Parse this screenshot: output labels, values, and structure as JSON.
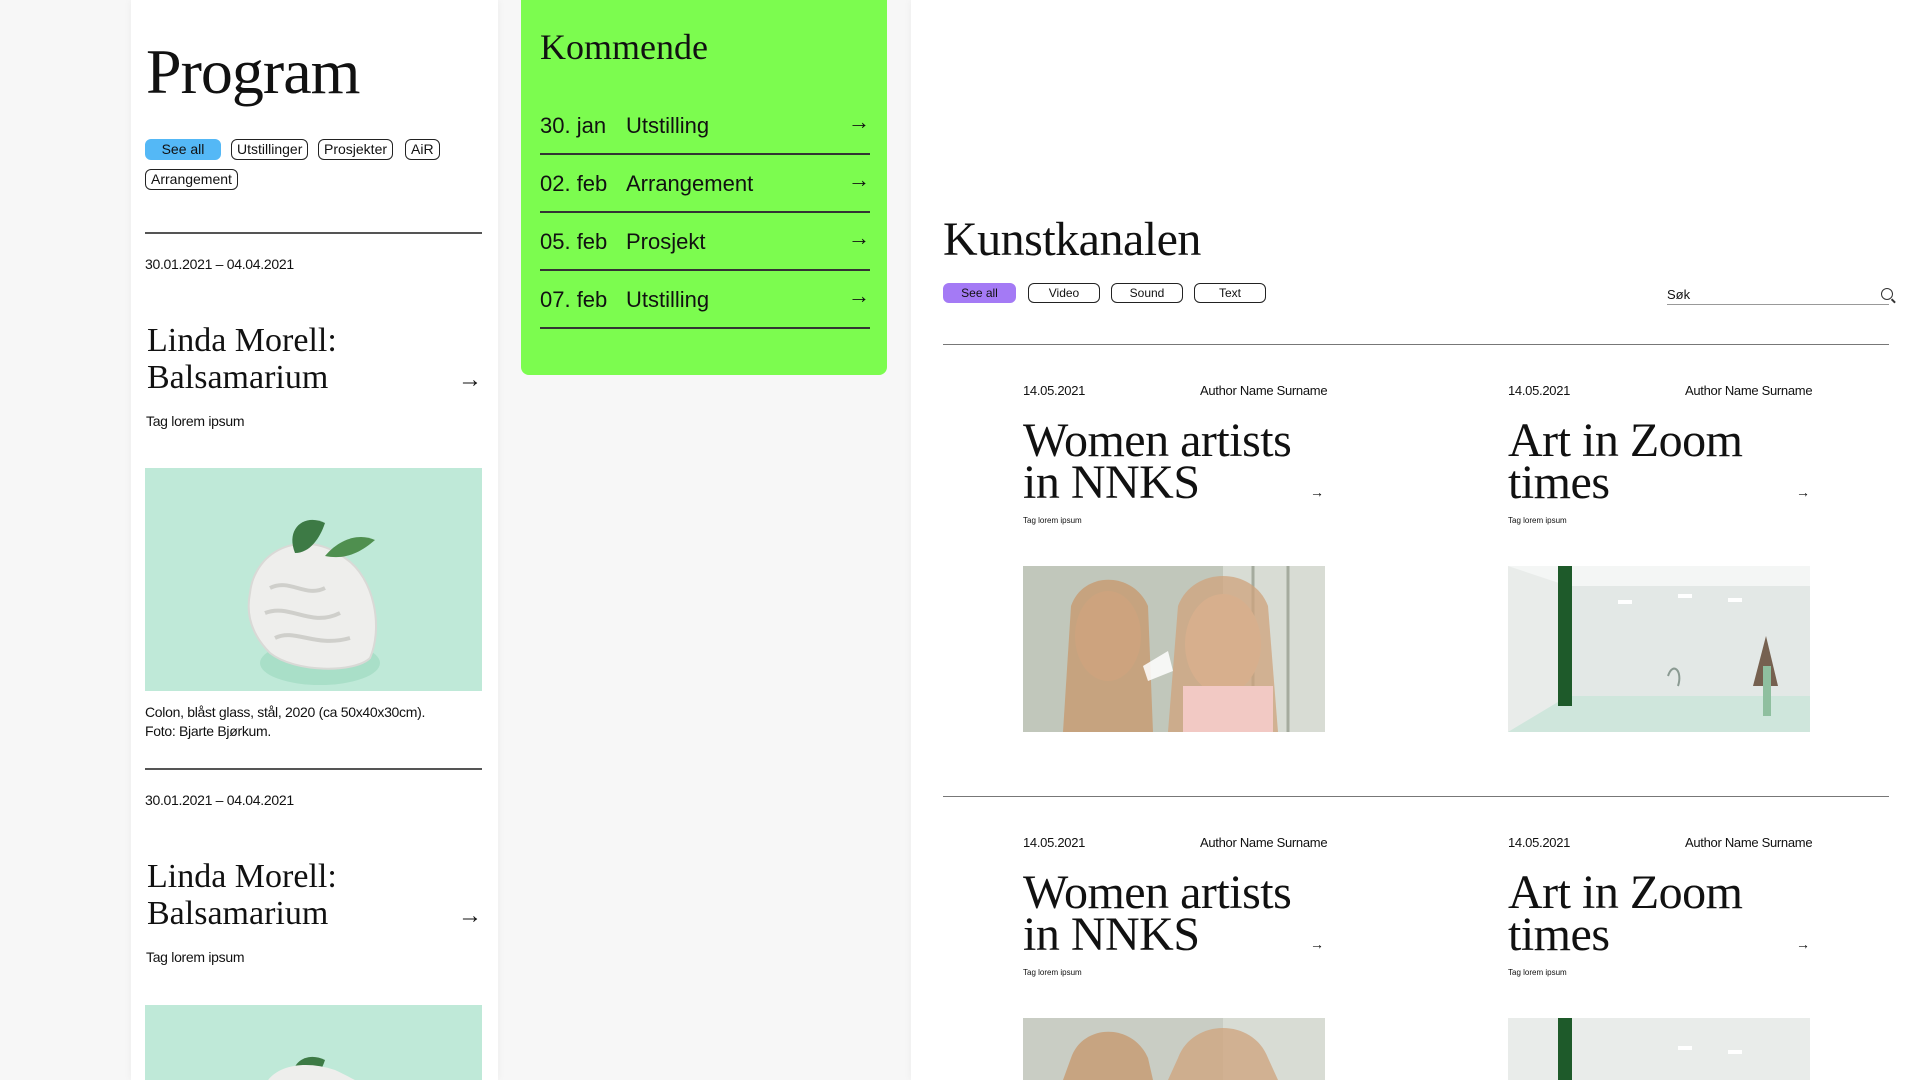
{
  "program": {
    "title": "Program",
    "filters": [
      "See all",
      "Utstillinger",
      "Prosjekter",
      "AiR",
      "Arrangement"
    ],
    "entries": [
      {
        "dates": "30.01.2021 – 04.04.2021",
        "title_line1": "Linda Morell:",
        "title_line2": "Balsamarium",
        "tag": "Tag lorem ipsum",
        "caption_line1": "Colon, blåst glass, stål, 2020 (ca 50x40x30cm).",
        "caption_line2": "Foto: Bjarte Bjørkum."
      },
      {
        "dates": "30.01.2021 – 04.04.2021",
        "title_line1": "Linda Morell:",
        "title_line2": "Balsamarium",
        "tag": "Tag lorem ipsum"
      }
    ]
  },
  "kommende": {
    "title": "Kommende",
    "rows": [
      {
        "date": "30. jan",
        "type": "Utstilling"
      },
      {
        "date": "02. feb",
        "type": "Arrangement"
      },
      {
        "date": "05. feb",
        "type": "Prosjekt"
      },
      {
        "date": "07. feb",
        "type": "Utstilling"
      }
    ]
  },
  "kunstkanalen": {
    "title": "Kunstkanalen",
    "filters": [
      "See all",
      "Video",
      "Sound",
      "Text"
    ],
    "search_label": "Søk",
    "cards": [
      {
        "date": "14.05.2021",
        "author": "Author Name Surname",
        "title_line1": "Women artists",
        "title_line2": "in NNKS",
        "tag": "Tag lorem ipsum"
      },
      {
        "date": "14.05.2021",
        "author": "Author Name Surname",
        "title_line1": "Art in Zoom",
        "title_line2": "times",
        "tag": "Tag lorem ipsum"
      },
      {
        "date": "14.05.2021",
        "author": "Author Name Surname",
        "title_line1": "Women artists",
        "title_line2": "in NNKS",
        "tag": "Tag lorem ipsum"
      },
      {
        "date": "14.05.2021",
        "author": "Author Name Surname",
        "title_line1": "Art in Zoom",
        "title_line2": "times",
        "tag": "Tag lorem ipsum"
      }
    ]
  },
  "icons": {
    "arrow": "arrow-right-icon",
    "search": "search-icon"
  },
  "colors": {
    "kommende_bg": "#7cfc4f",
    "program_active": "#54b8f6",
    "kunst_active": "#a47af5"
  }
}
